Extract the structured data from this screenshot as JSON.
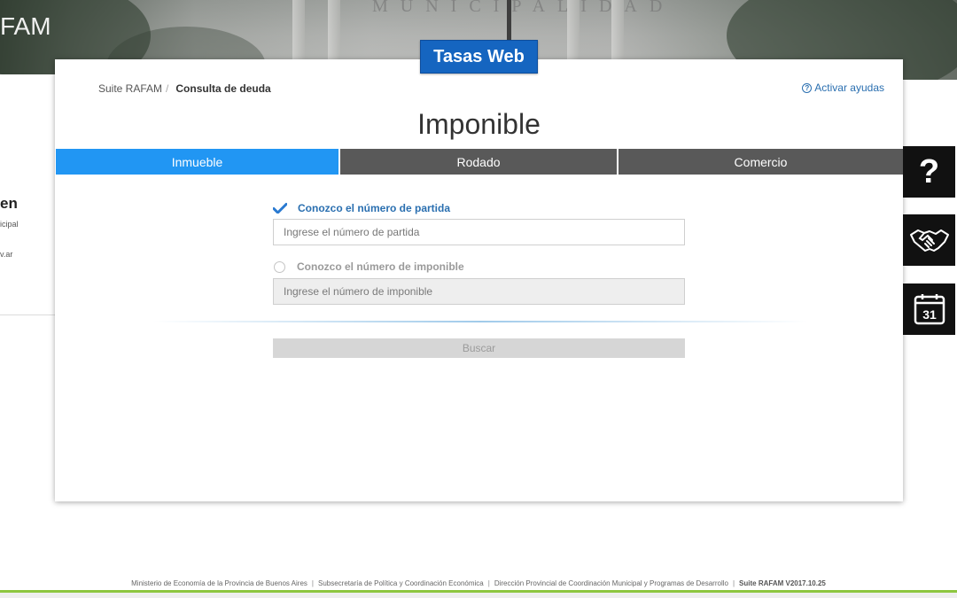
{
  "brand": {
    "fragment": "FAM",
    "inscription": "MUNICIPALIDAD"
  },
  "app_badge": "Tasas Web",
  "side_panel": {
    "title_fragment": "en",
    "line1_fragment": "icipal",
    "line2_fragment": "v.ar"
  },
  "breadcrumb": {
    "root": "Suite RAFAM",
    "separator": "/",
    "current": "Consulta de deuda"
  },
  "help_toggle": {
    "label": "Activar ayudas",
    "icon": "question-circle-icon"
  },
  "page_title": "Imponible",
  "tabs": [
    {
      "label": "Inmueble",
      "active": true
    },
    {
      "label": "Rodado",
      "active": false
    },
    {
      "label": "Comercio",
      "active": false
    }
  ],
  "form": {
    "option_partida": {
      "label": "Conozco el número de partida",
      "selected": true,
      "placeholder": "Ingrese el número de partida",
      "value": ""
    },
    "option_imponible": {
      "label": "Conozco el número de imponible",
      "selected": false,
      "placeholder": "Ingrese el número de imponible",
      "value": ""
    },
    "search_label": "Buscar"
  },
  "side_tools": [
    {
      "icon": "question-mark-icon"
    },
    {
      "icon": "handshake-icon"
    },
    {
      "icon": "calendar-icon",
      "day": "31"
    }
  ],
  "footer": {
    "items": [
      "Ministerio de Economía de la Provincia de Buenos Aires",
      "Subsecretaría de Política y Coordinación Económica",
      "Dirección Provincial de Coordinación Municipal y Programas de Desarrollo"
    ],
    "version": "Suite RAFAM V2017.10.25",
    "separator": "|"
  },
  "colors": {
    "accent": "#2196f3",
    "badge": "#1565c0",
    "tab_inactive": "#595959",
    "footer_bar": "#8dc63f",
    "link": "#2a6fb0"
  }
}
